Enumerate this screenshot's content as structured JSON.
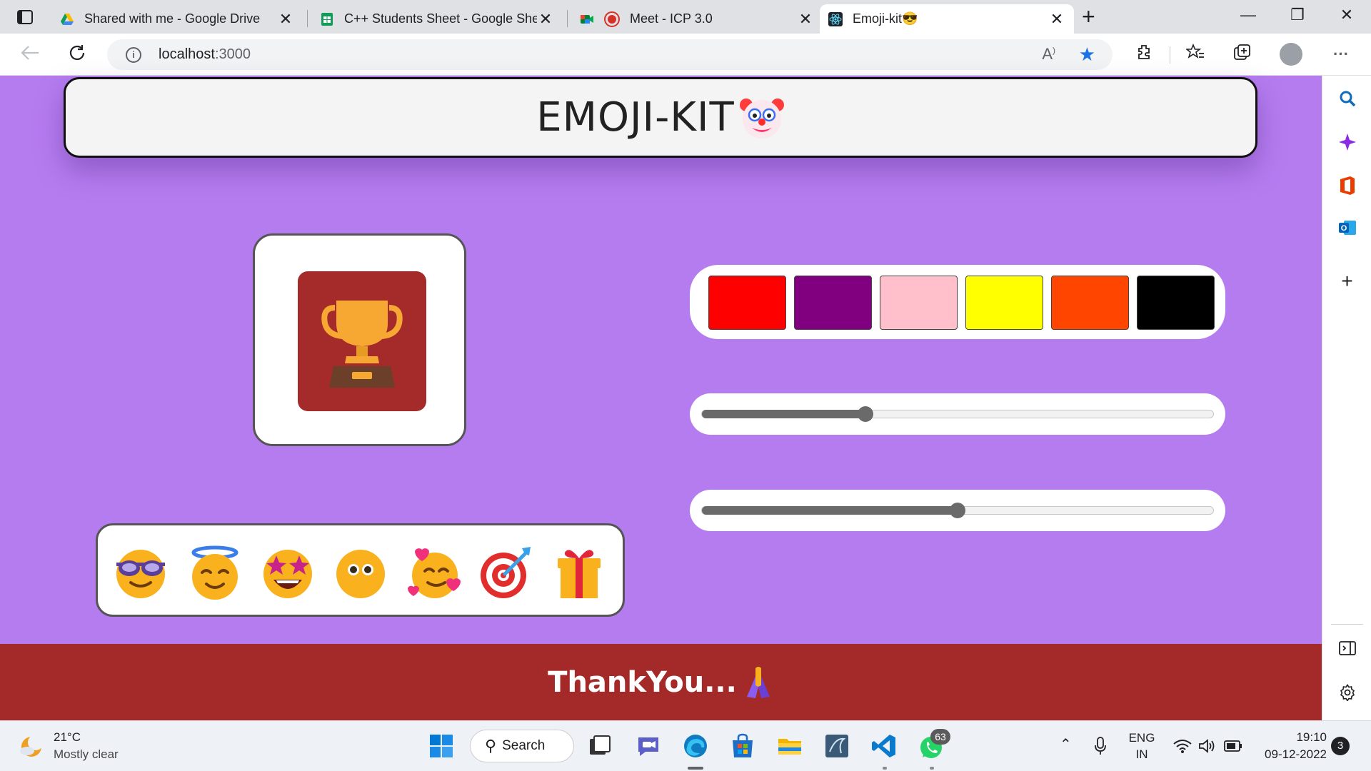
{
  "browser": {
    "tabs": [
      {
        "title": "Shared with me - Google Drive",
        "icon": "google-drive-icon"
      },
      {
        "title": "C++ Students Sheet - Google Sheets",
        "icon": "google-sheets-icon"
      },
      {
        "title": "Meet - ICP 3.0",
        "icon": "google-meet-icon"
      },
      {
        "title": "Emoji-kit😎",
        "icon": "react-icon",
        "active": true
      }
    ],
    "tab_close_glyph": "✕",
    "new_tab_glyph": "+",
    "window_controls": [
      "—",
      "❐",
      "✕"
    ],
    "address": {
      "host": "localhost",
      "port": ":3000"
    },
    "read_aloud_glyph": "Aₑ",
    "star_glyph": "★",
    "more_glyph": "···"
  },
  "page": {
    "header_title": "EMOJI-KIT",
    "colors": [
      "#ff0000",
      "#800080",
      "#ffc0cb",
      "#ffff00",
      "#ff4500",
      "#000000"
    ],
    "preview_background": "#a52a2a",
    "slider_size_value": 0.32,
    "slider_second_value": 0.5,
    "emoji_icons": [
      "smiling-face-with-sunglasses",
      "smiling-face-with-halo",
      "star-struck",
      "face-with-open-eyes",
      "smiling-face-with-hearts",
      "direct-hit",
      "wrapped-gift"
    ],
    "footer_text": "ThankYou..."
  },
  "taskbar": {
    "weather_temp": "21°C",
    "weather_desc": "Mostly clear",
    "search_label": "Search",
    "whatsapp_badge": "63",
    "language_top": "ENG",
    "language_bottom": "IN",
    "time": "19:10",
    "date": "09-12-2022",
    "notification_count": "3"
  }
}
